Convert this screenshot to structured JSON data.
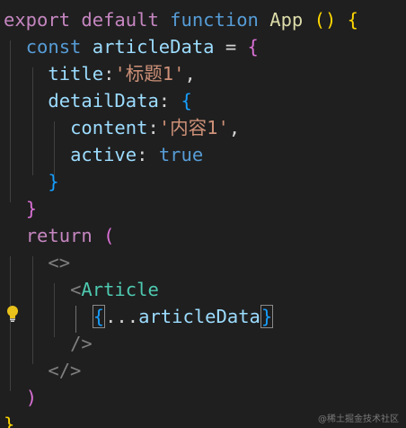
{
  "editor": {
    "theme": {
      "background": "#1f1f1f",
      "keyword": "#569cd6",
      "control": "#c586c0",
      "function": "#dcdcaa",
      "variable": "#9cdcfe",
      "string": "#ce9178",
      "punctuation": "#d4d4d4",
      "bracket_level1": "#ffd700",
      "bracket_level2": "#da70d6",
      "bracket_level3": "#179fff",
      "jsx_tag": "#808080",
      "component": "#4ec9b0"
    },
    "gutter_icon": "lightbulb-icon",
    "lines": [
      [
        {
          "t": "export",
          "c": "ctl"
        },
        {
          "t": " ",
          "c": "plain"
        },
        {
          "t": "default",
          "c": "ctl"
        },
        {
          "t": " ",
          "c": "plain"
        },
        {
          "t": "function",
          "c": "kw"
        },
        {
          "t": " ",
          "c": "plain"
        },
        {
          "t": "App",
          "c": "fn"
        },
        {
          "t": " ",
          "c": "plain"
        },
        {
          "t": "()",
          "c": "b1"
        },
        {
          "t": " ",
          "c": "plain"
        },
        {
          "t": "{",
          "c": "b1"
        }
      ],
      [
        {
          "t": "  ",
          "c": "plain"
        },
        {
          "t": "const",
          "c": "kw"
        },
        {
          "t": " ",
          "c": "plain"
        },
        {
          "t": "articleData",
          "c": "var"
        },
        {
          "t": " = ",
          "c": "plain"
        },
        {
          "t": "{",
          "c": "b2"
        }
      ],
      [
        {
          "t": "    ",
          "c": "plain"
        },
        {
          "t": "title",
          "c": "var"
        },
        {
          "t": ":",
          "c": "plain"
        },
        {
          "t": "'标题1'",
          "c": "str"
        },
        {
          "t": ",",
          "c": "plain"
        }
      ],
      [
        {
          "t": "    ",
          "c": "plain"
        },
        {
          "t": "detailData",
          "c": "var"
        },
        {
          "t": ": ",
          "c": "plain"
        },
        {
          "t": "{",
          "c": "b3"
        }
      ],
      [
        {
          "t": "      ",
          "c": "plain"
        },
        {
          "t": "content",
          "c": "var"
        },
        {
          "t": ":",
          "c": "plain"
        },
        {
          "t": "'内容1'",
          "c": "str"
        },
        {
          "t": ",",
          "c": "plain"
        }
      ],
      [
        {
          "t": "      ",
          "c": "plain"
        },
        {
          "t": "active",
          "c": "var"
        },
        {
          "t": ": ",
          "c": "plain"
        },
        {
          "t": "true",
          "c": "kw"
        }
      ],
      [
        {
          "t": "    ",
          "c": "plain"
        },
        {
          "t": "}",
          "c": "b3"
        }
      ],
      [
        {
          "t": "  ",
          "c": "plain"
        },
        {
          "t": "}",
          "c": "b2"
        }
      ],
      [
        {
          "t": "  ",
          "c": "plain"
        },
        {
          "t": "return",
          "c": "ctl"
        },
        {
          "t": " ",
          "c": "plain"
        },
        {
          "t": "(",
          "c": "b2"
        }
      ],
      [
        {
          "t": "    ",
          "c": "plain"
        },
        {
          "t": "<>",
          "c": "tag"
        }
      ],
      [
        {
          "t": "      ",
          "c": "plain"
        },
        {
          "t": "<",
          "c": "tag"
        },
        {
          "t": "Article",
          "c": "comp"
        }
      ],
      [
        {
          "t": "        ",
          "c": "plain"
        },
        {
          "t": "{",
          "c": "b3",
          "box": true
        },
        {
          "t": "...",
          "c": "plain"
        },
        {
          "t": "articleData",
          "c": "var"
        },
        {
          "t": "}",
          "c": "b3",
          "box": true
        }
      ],
      [
        {
          "t": "      ",
          "c": "plain"
        },
        {
          "t": "/>",
          "c": "tag"
        }
      ],
      [
        {
          "t": "    ",
          "c": "plain"
        },
        {
          "t": "</>",
          "c": "tag"
        }
      ],
      [
        {
          "t": "  ",
          "c": "plain"
        },
        {
          "t": ")",
          "c": "b2"
        }
      ],
      [
        {
          "t": "}",
          "c": "b1"
        }
      ]
    ]
  },
  "watermark": {
    "text": "@稀土掘金技术社区"
  }
}
